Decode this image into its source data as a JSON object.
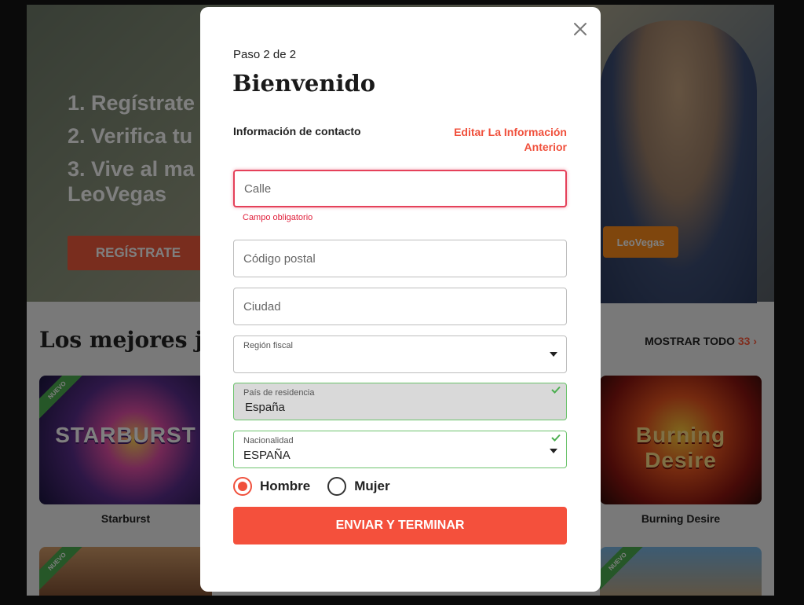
{
  "background": {
    "hero_steps": [
      "1. Regístrate",
      "2. Verifica tu",
      "3. Vive al ma",
      "LeoVegas"
    ],
    "hero_button": "REGÍSTRATE",
    "card_label": "LeoVegas",
    "section_title": "Los mejores ju",
    "show_all_label": "MOSTRAR TODO",
    "show_all_count": "33",
    "show_all_icon": "chevron-right-icon",
    "games": [
      {
        "name": "Starburst",
        "logo": "STARBURST"
      },
      {
        "name": "Burning Desire",
        "logo": "Burning Desire"
      }
    ],
    "new_badge": "NUEVO"
  },
  "modal": {
    "step": "Paso 2 de 2",
    "title": "Bienvenido",
    "section_label": "Información de contacto",
    "edit_link": "Editar La Información Anterior",
    "close_icon": "close-icon",
    "fields": {
      "street": {
        "placeholder": "Calle",
        "value": "",
        "state": "error",
        "error_message": "Campo obligatorio"
      },
      "postal_code": {
        "placeholder": "Código postal",
        "value": ""
      },
      "city": {
        "placeholder": "Ciudad",
        "value": ""
      },
      "tax_region": {
        "label": "Región fiscal",
        "value": ""
      },
      "country_of_residence": {
        "label": "País de residencia",
        "value": "España",
        "state": "valid",
        "disabled": true
      },
      "nationality": {
        "label": "Nacionalidad",
        "value": "ESPAÑA",
        "state": "valid"
      }
    },
    "gender": {
      "options": [
        {
          "label": "Hombre",
          "checked": true
        },
        {
          "label": "Mujer",
          "checked": false
        }
      ]
    },
    "submit_label": "ENVIAR Y TERMINAR"
  },
  "colors": {
    "accent": "#f4503c",
    "error": "#e5415a",
    "valid": "#6cc36c"
  }
}
